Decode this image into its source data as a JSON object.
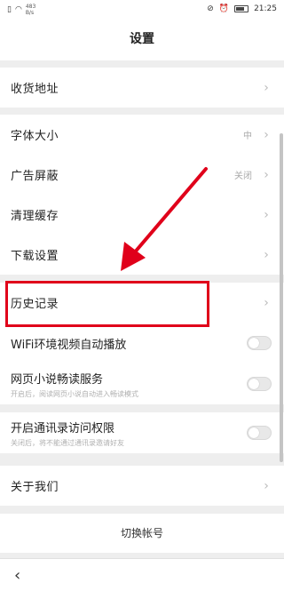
{
  "status": {
    "net_rate": "483",
    "net_unit": "B/s",
    "time": "21:25"
  },
  "header": {
    "title": "设置"
  },
  "rows": {
    "address": {
      "label": "收货地址"
    },
    "font_size": {
      "label": "字体大小",
      "value": "中"
    },
    "ad_block": {
      "label": "广告屏蔽",
      "value": "关闭"
    },
    "clear_cache": {
      "label": "清理缓存"
    },
    "download": {
      "label": "下载设置"
    },
    "history": {
      "label": "历史记录"
    },
    "wifi_autoplay": {
      "label": "WiFi环境视频自动播放"
    },
    "novel": {
      "label": "网页小说畅读服务",
      "sub": "开启后，阅读网页小说自动进入畅读模式"
    },
    "contacts": {
      "label": "开启通讯录访问权限",
      "sub": "关闭后，将不能通过通讯录邀请好友"
    },
    "about": {
      "label": "关于我们"
    }
  },
  "switch_account": "切换帐号",
  "colors": {
    "annotation": "#e0001a"
  }
}
